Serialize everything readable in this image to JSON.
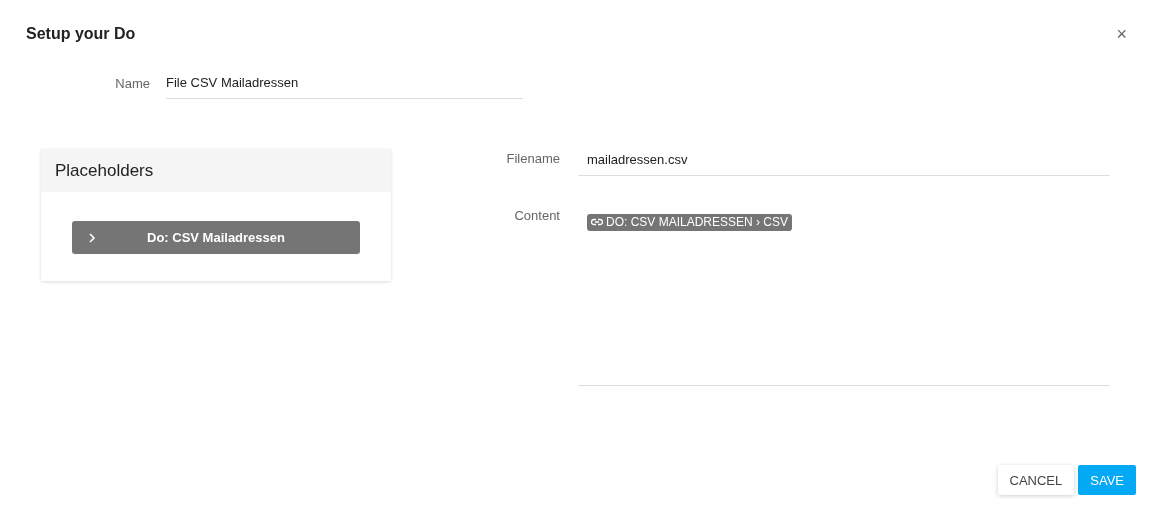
{
  "dialog": {
    "title": "Setup your Do",
    "close": "×"
  },
  "name_field": {
    "label": "Name",
    "value": "File CSV Mailadressen"
  },
  "placeholders": {
    "title": "Placeholders",
    "items": [
      {
        "label": "Do: CSV Mailadressen",
        "expanded": false
      }
    ]
  },
  "filename_field": {
    "label": "Filename",
    "value": "mailadressen.csv"
  },
  "content_field": {
    "label": "Content",
    "chips": [
      "DO: CSV MAILADRESSEN › CSV"
    ]
  },
  "buttons": [
    {
      "label": "CANCEL",
      "kind": "flat"
    },
    {
      "label": "SAVE",
      "kind": "primary"
    }
  ]
}
